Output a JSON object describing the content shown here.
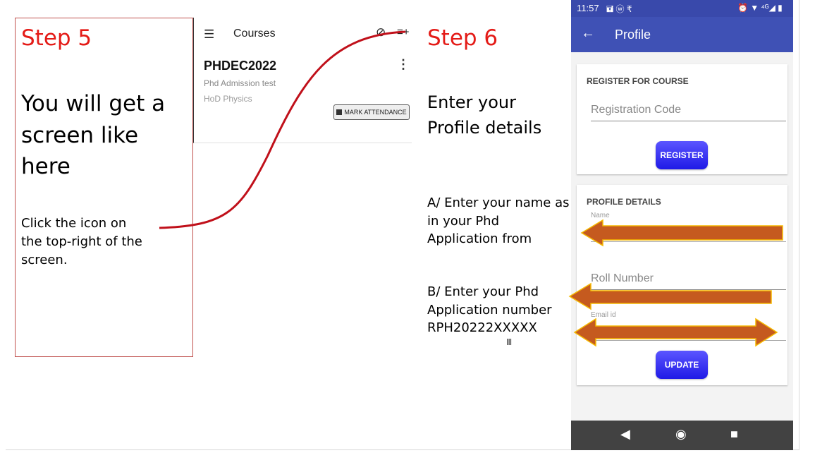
{
  "step5": {
    "title": "Step 5",
    "main_lines": [
      "You will get a",
      "screen like",
      "here"
    ],
    "instruction_lines": [
      "Click the icon on",
      "the top-right of the",
      "screen."
    ]
  },
  "courses_screen": {
    "menu_icon": "hamburger-menu-icon",
    "title": "Courses",
    "sync_icon": "sync-icon",
    "add_icon": "add-list-icon",
    "course_code": "PHDEC2022",
    "course_name": "Phd Admission test",
    "course_owner": "HoD Physics",
    "attendance_button": "MARK ATTENDANCE"
  },
  "step6": {
    "title": "Step 6",
    "main_lines": [
      "Enter your",
      "Profile details"
    ],
    "note_a_lines": [
      "A/ Enter your name as",
      "in your Phd",
      "Application from"
    ],
    "note_b_lines": [
      "B/ Enter your Phd",
      "Application number",
      "RPH20222XXXXX"
    ]
  },
  "phone": {
    "status_time": "11:57",
    "status_icons_left": "🖬 ⓦ ₹",
    "status_icons_right": "⏰ ▼ ⁴ᴳ◢ ▮",
    "appbar_title": "Profile",
    "register_card": {
      "heading": "REGISTER FOR COURSE",
      "placeholder": "Registration Code",
      "button": "REGISTER"
    },
    "profile_card": {
      "heading": "PROFILE DETAILS",
      "name_label": "Name",
      "roll_placeholder": "Roll Number",
      "email_label": "Email id",
      "button": "UPDATE"
    },
    "nav": {
      "back": "◀",
      "home": "◉",
      "recents": "■"
    }
  },
  "colors": {
    "step_title": "#e41b17",
    "arrow_fill": "#c55a1f",
    "arrow_stroke": "#f5b800",
    "curve": "#c0101a",
    "appbar": "#3f51b5",
    "button": "#2a25f0"
  }
}
